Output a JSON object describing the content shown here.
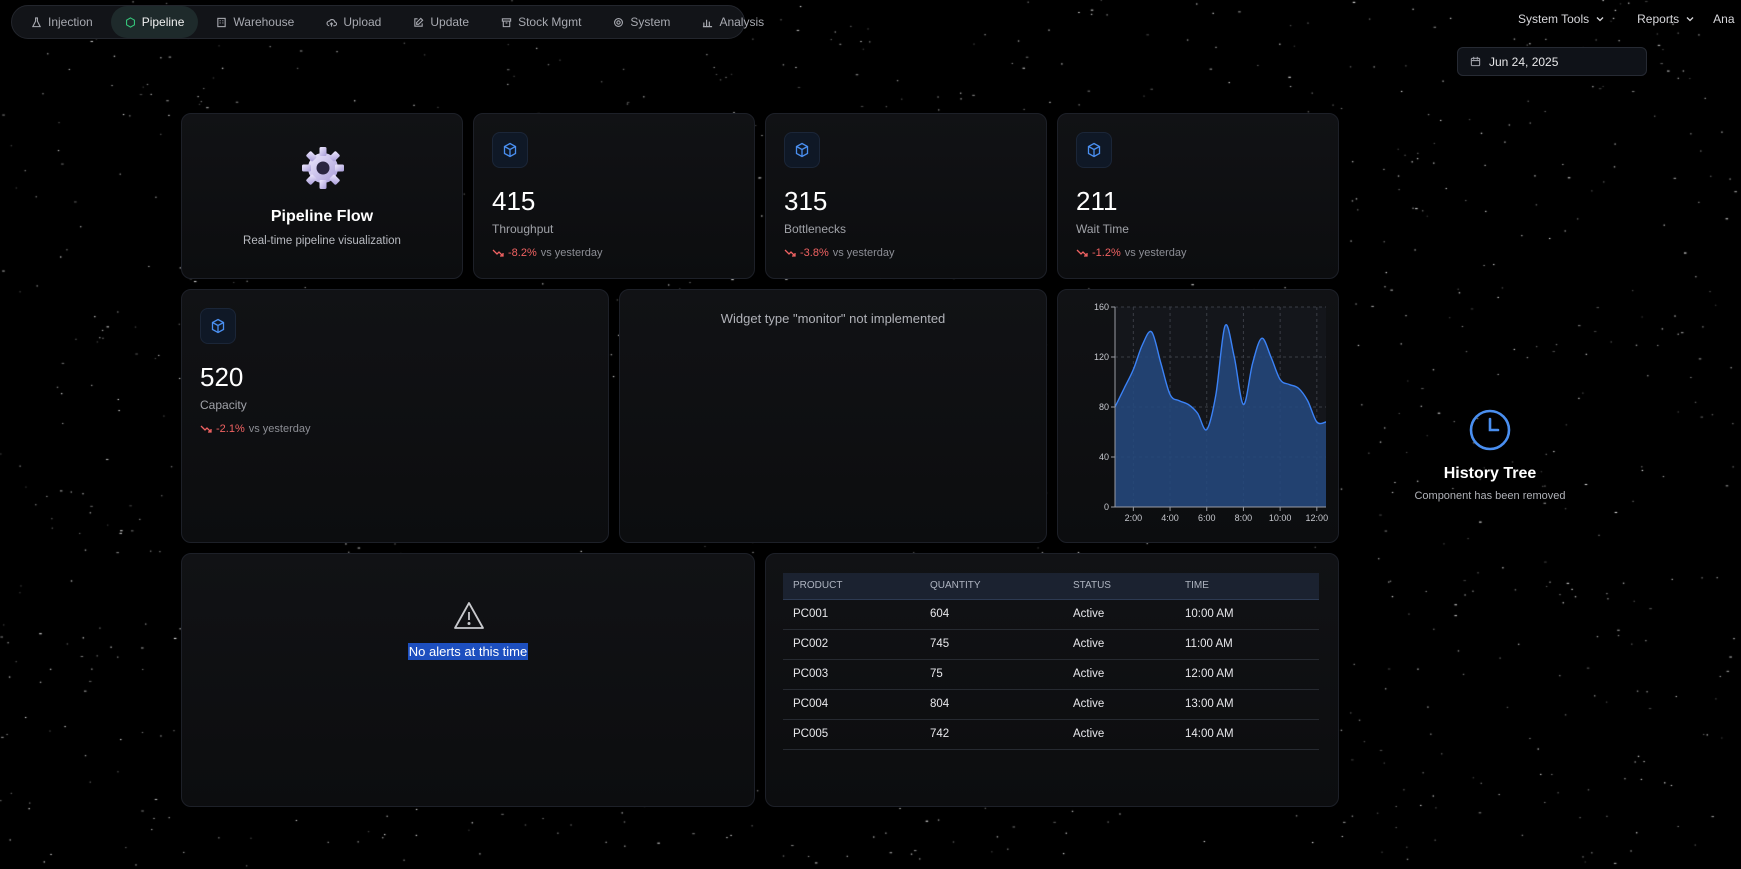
{
  "nav": {
    "items": [
      {
        "label": "Injection",
        "icon": "flask-icon",
        "active": false
      },
      {
        "label": "Pipeline",
        "icon": "hexagon-icon",
        "active": true
      },
      {
        "label": "Warehouse",
        "icon": "building-icon",
        "active": false
      },
      {
        "label": "Upload",
        "icon": "cloud-upload-icon",
        "active": false
      },
      {
        "label": "Update",
        "icon": "edit-icon",
        "active": false
      },
      {
        "label": "Stock Mgmt",
        "icon": "archive-icon",
        "active": false
      },
      {
        "label": "System",
        "icon": "gear-icon",
        "active": false
      },
      {
        "label": "Analysis",
        "icon": "bar-chart-icon",
        "active": false
      }
    ],
    "right_menus": [
      {
        "label": "System Tools"
      },
      {
        "label": "Reports"
      },
      {
        "label": "Ana"
      }
    ]
  },
  "date_picker": {
    "value": "Jun 24, 2025"
  },
  "pipeline_flow": {
    "title": "Pipeline Flow",
    "subtitle": "Real-time pipeline visualization"
  },
  "stats": [
    {
      "value": "415",
      "label": "Throughput",
      "trend": "-8.2%",
      "suffix": "vs yesterday"
    },
    {
      "value": "315",
      "label": "Bottlenecks",
      "trend": "-3.8%",
      "suffix": "vs yesterday"
    },
    {
      "value": "211",
      "label": "Wait Time",
      "trend": "-1.2%",
      "suffix": "vs yesterday"
    },
    {
      "value": "520",
      "label": "Capacity",
      "trend": "-2.1%",
      "suffix": "vs yesterday"
    }
  ],
  "monitor_widget": {
    "message": "Widget type \"monitor\" not implemented"
  },
  "alerts": {
    "message": "No alerts at this time"
  },
  "table": {
    "headers": [
      "PRODUCT",
      "QUANTITY",
      "STATUS",
      "TIME"
    ],
    "rows": [
      [
        "PC001",
        "604",
        "Active",
        "10:00 AM"
      ],
      [
        "PC002",
        "745",
        "Active",
        "11:00 AM"
      ],
      [
        "PC003",
        "75",
        "Active",
        "12:00 AM"
      ],
      [
        "PC004",
        "804",
        "Active",
        "13:00 AM"
      ],
      [
        "PC005",
        "742",
        "Active",
        "14:00 AM"
      ]
    ]
  },
  "history_tree": {
    "title": "History Tree",
    "subtitle": "Component has been removed"
  },
  "colors": {
    "accent": "#3b82f6",
    "area_fill": "#25497f",
    "negative": "#f06262",
    "active_nav": "#35c47a"
  },
  "chart_data": {
    "type": "area",
    "x": [
      "1:00",
      "1:30",
      "2:00",
      "2:30",
      "3:00",
      "3:30",
      "4:00",
      "4:30",
      "5:00",
      "5:30",
      "6:00",
      "6:30",
      "7:00",
      "7:30",
      "8:00",
      "8:30",
      "9:00",
      "9:30",
      "10:00",
      "10:30",
      "11:00",
      "11:30",
      "12:00",
      "12:30"
    ],
    "values": [
      80,
      95,
      110,
      130,
      140,
      115,
      90,
      85,
      82,
      75,
      62,
      90,
      145,
      120,
      82,
      115,
      135,
      120,
      102,
      98,
      95,
      85,
      68,
      68
    ],
    "xticks": [
      "2:00",
      "4:00",
      "6:00",
      "8:00",
      "10:00",
      "12:00"
    ],
    "yticks": [
      "0",
      "40",
      "80",
      "120",
      "160"
    ],
    "ylim": [
      0,
      160
    ],
    "grid": true,
    "title": "",
    "xlabel": "",
    "ylabel": ""
  }
}
